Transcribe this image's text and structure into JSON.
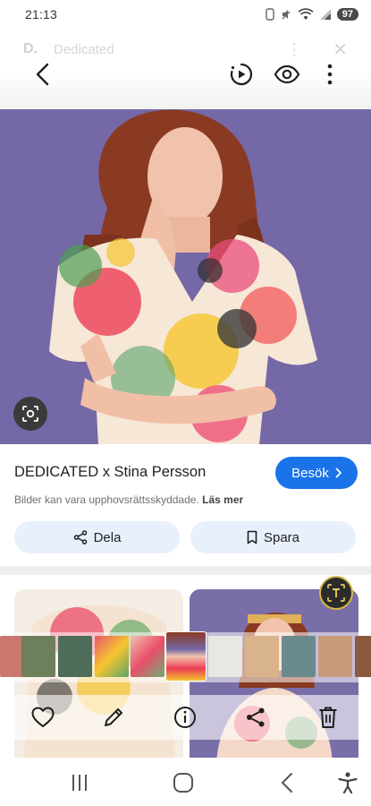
{
  "status_bar": {
    "time": "21:13",
    "battery": "97"
  },
  "ghost_header": {
    "logo": "D.",
    "title": "Dedicated"
  },
  "info": {
    "title": "DEDICATED x Stina Persson",
    "visit_label": "Besök",
    "copyright_text": "Bilder kan vara upphovsrättsskyddade.",
    "learn_more": "Läs mer",
    "share_label": "Dela",
    "save_label": "Spara"
  },
  "colors": {
    "accent": "#1a73e8",
    "pill_bg": "#e8f0fc",
    "hero_bg": "#7468a6"
  },
  "icons": {
    "back": "arrow-left-icon",
    "motion": "motion-photo-icon",
    "visibility": "eye-icon",
    "more": "more-vertical-icon",
    "lens": "lens-icon",
    "share": "share-icon",
    "save": "bookmark-icon",
    "text_select": "text-select-icon",
    "favorite": "heart-icon",
    "edit": "pencil-icon",
    "details": "info-icon",
    "delete": "trash-icon",
    "recent_apps": "recent-apps-icon",
    "home": "home-icon",
    "nav_back": "nav-back-icon",
    "accessibility": "accessibility-icon"
  }
}
